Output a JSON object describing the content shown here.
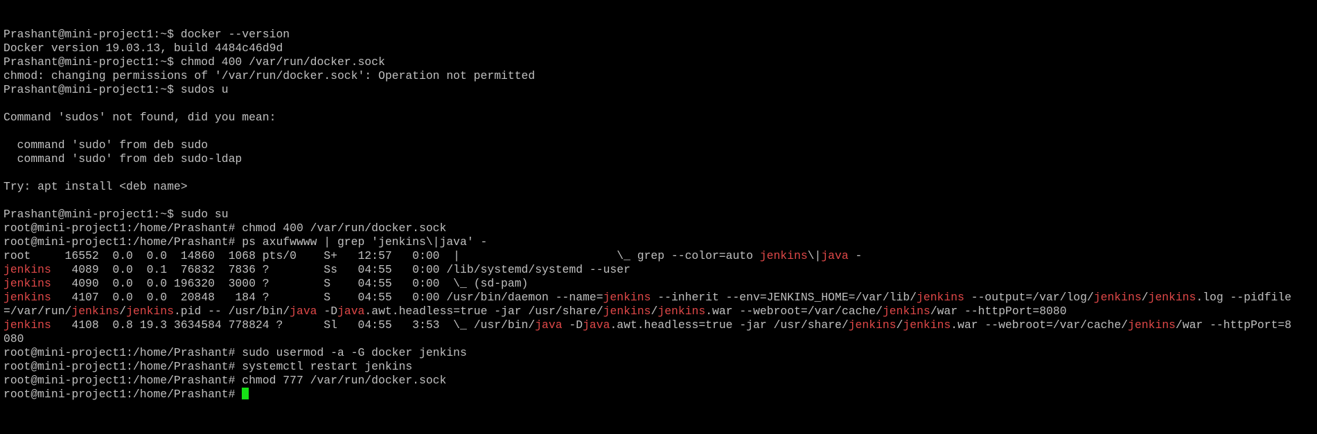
{
  "terminal": {
    "colors": {
      "background": "#000000",
      "foreground": "#c0c0c0",
      "highlight": "#e04848",
      "cursor": "#16e016"
    },
    "lines": [
      [
        {
          "t": "Prashant@mini-project1:~$ docker --version"
        }
      ],
      [
        {
          "t": "Docker version 19.03.13, build 4484c46d9d"
        }
      ],
      [
        {
          "t": "Prashant@mini-project1:~$ chmod 400 /var/run/docker.sock"
        }
      ],
      [
        {
          "t": "chmod: changing permissions of '/var/run/docker.sock': Operation not permitted"
        }
      ],
      [
        {
          "t": "Prashant@mini-project1:~$ sudos u"
        }
      ],
      [
        {
          "t": ""
        }
      ],
      [
        {
          "t": "Command 'sudos' not found, did you mean:"
        }
      ],
      [
        {
          "t": ""
        }
      ],
      [
        {
          "t": "  command 'sudo' from deb sudo"
        }
      ],
      [
        {
          "t": "  command 'sudo' from deb sudo-ldap"
        }
      ],
      [
        {
          "t": ""
        }
      ],
      [
        {
          "t": "Try: apt install <deb name>"
        }
      ],
      [
        {
          "t": ""
        }
      ],
      [
        {
          "t": "Prashant@mini-project1:~$ sudo su"
        }
      ],
      [
        {
          "t": "root@mini-project1:/home/Prashant# chmod 400 /var/run/docker.sock"
        }
      ],
      [
        {
          "t": "root@mini-project1:/home/Prashant# ps axufwwww | grep 'jenkins\\|java' -"
        }
      ],
      [
        {
          "t": "root     16552  0.0  0.0  14860  1068 pts/0    S+   12:57   0:00  |                       \\_ grep --color=auto "
        },
        {
          "t": "jenkins",
          "h": true
        },
        {
          "t": "\\|"
        },
        {
          "t": "java",
          "h": true
        },
        {
          "t": " -"
        }
      ],
      [
        {
          "t": "jenkins",
          "h": true
        },
        {
          "t": "   4089  0.0  0.1  76832  7836 ?        Ss   04:55   0:00 /lib/systemd/systemd --user"
        }
      ],
      [
        {
          "t": "jenkins",
          "h": true
        },
        {
          "t": "   4090  0.0  0.0 196320  3000 ?        S    04:55   0:00  \\_ (sd-pam)"
        }
      ],
      [
        {
          "t": "jenkins",
          "h": true
        },
        {
          "t": "   4107  0.0  0.0  20848   184 ?        S    04:55   0:00 /usr/bin/daemon --name="
        },
        {
          "t": "jenkins",
          "h": true
        },
        {
          "t": " --inherit --env=JENKINS_HOME=/var/lib/"
        },
        {
          "t": "jenkins",
          "h": true
        },
        {
          "t": " --output=/var/log/"
        },
        {
          "t": "jenkins",
          "h": true
        },
        {
          "t": "/"
        },
        {
          "t": "jenkins",
          "h": true
        },
        {
          "t": ".log --pidfile"
        }
      ],
      [
        {
          "t": "=/var/run/"
        },
        {
          "t": "jenkins",
          "h": true
        },
        {
          "t": "/"
        },
        {
          "t": "jenkins",
          "h": true
        },
        {
          "t": ".pid -- /usr/bin/"
        },
        {
          "t": "java",
          "h": true
        },
        {
          "t": " -D"
        },
        {
          "t": "java",
          "h": true
        },
        {
          "t": ".awt.headless=true -jar /usr/share/"
        },
        {
          "t": "jenkins",
          "h": true
        },
        {
          "t": "/"
        },
        {
          "t": "jenkins",
          "h": true
        },
        {
          "t": ".war --webroot=/var/cache/"
        },
        {
          "t": "jenkins",
          "h": true
        },
        {
          "t": "/war --httpPort=8080"
        }
      ],
      [
        {
          "t": "jenkins",
          "h": true
        },
        {
          "t": "   4108  0.8 19.3 3634584 778824 ?      Sl   04:55   3:53  \\_ /usr/bin/"
        },
        {
          "t": "java",
          "h": true
        },
        {
          "t": " -D"
        },
        {
          "t": "java",
          "h": true
        },
        {
          "t": ".awt.headless=true -jar /usr/share/"
        },
        {
          "t": "jenkins",
          "h": true
        },
        {
          "t": "/"
        },
        {
          "t": "jenkins",
          "h": true
        },
        {
          "t": ".war --webroot=/var/cache/"
        },
        {
          "t": "jenkins",
          "h": true
        },
        {
          "t": "/war --httpPort=8"
        }
      ],
      [
        {
          "t": "080"
        }
      ],
      [
        {
          "t": "root@mini-project1:/home/Prashant# sudo usermod -a -G docker jenkins"
        }
      ],
      [
        {
          "t": "root@mini-project1:/home/Prashant# systemctl restart jenkins"
        }
      ],
      [
        {
          "t": "root@mini-project1:/home/Prashant# chmod 777 /var/run/docker.sock"
        }
      ],
      [
        {
          "t": "root@mini-project1:/home/Prashant# "
        },
        {
          "cursor": true
        }
      ]
    ]
  }
}
